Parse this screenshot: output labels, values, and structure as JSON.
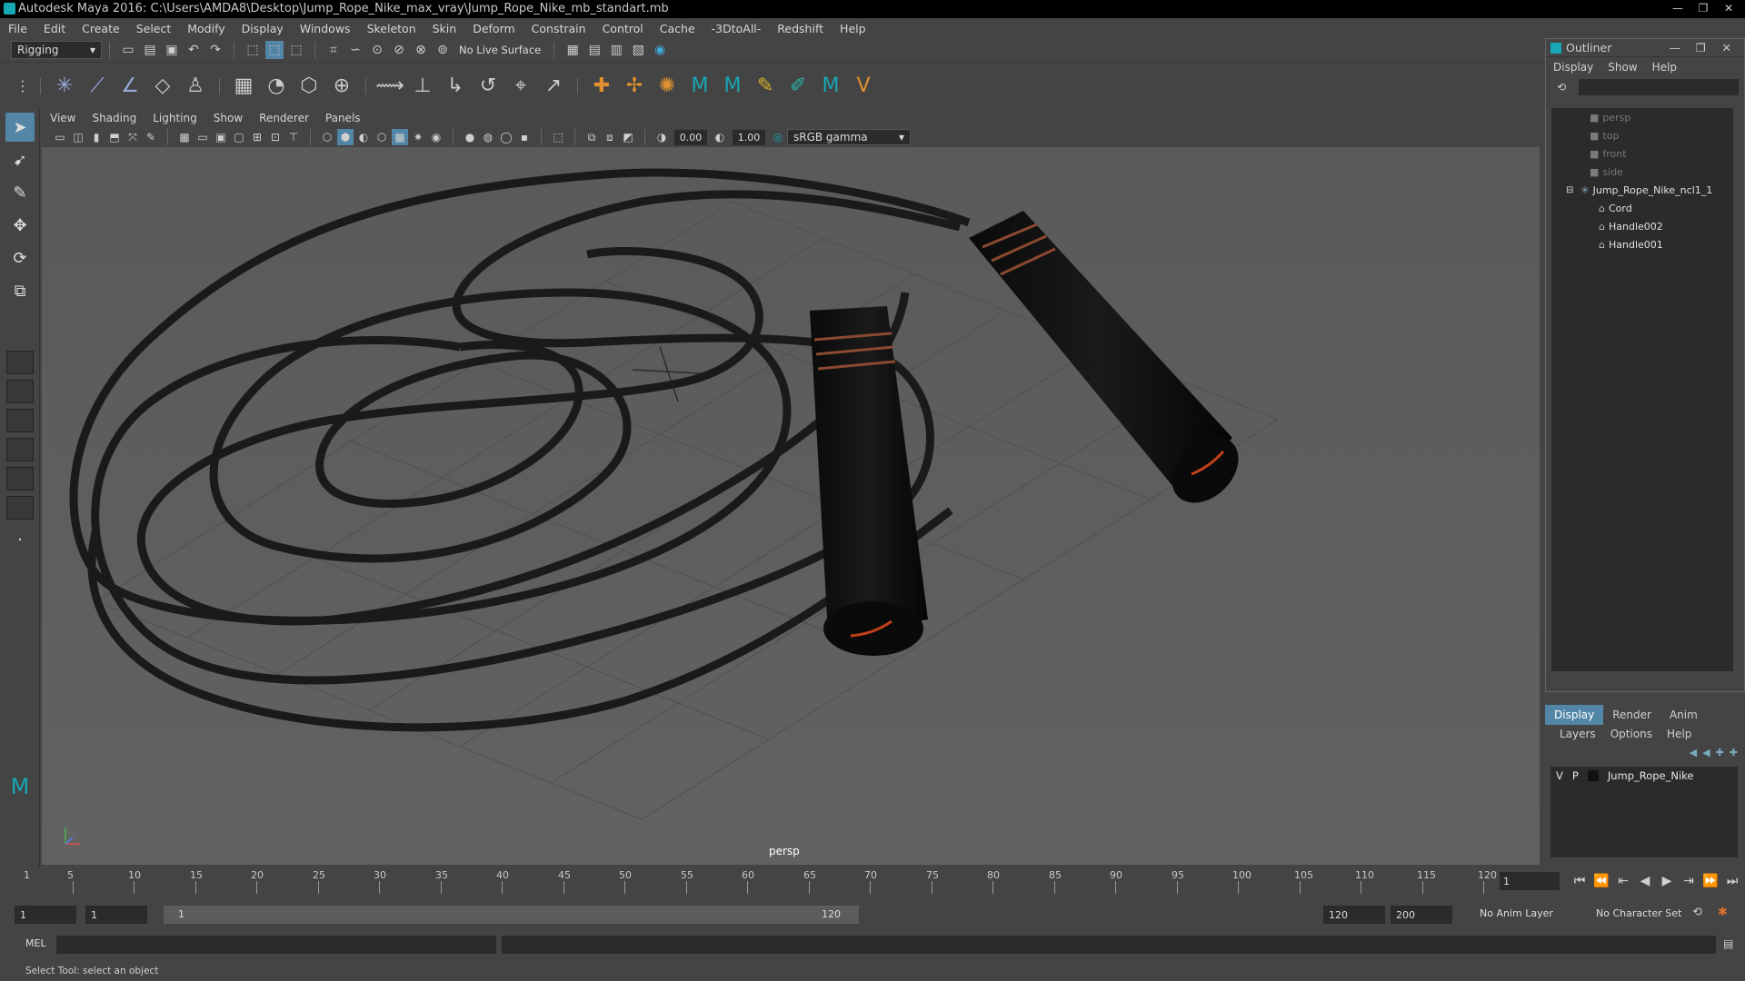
{
  "window": {
    "title": "Autodesk Maya 2016: C:\\Users\\AMDA8\\Desktop\\Jump_Rope_Nike_max_vray\\Jump_Rope_Nike_mb_standart.mb",
    "controls": [
      "—",
      "❐",
      "✕"
    ]
  },
  "menubar": [
    "File",
    "Edit",
    "Create",
    "Select",
    "Modify",
    "Display",
    "Windows",
    "Skeleton",
    "Skin",
    "Deform",
    "Constrain",
    "Control",
    "Cache",
    "-3DtoAll-",
    "Redshift",
    "Help"
  ],
  "statusline": {
    "menuset": "Rigging",
    "live_surface": "No Live Surface"
  },
  "panel": {
    "menus": [
      "View",
      "Shading",
      "Lighting",
      "Show",
      "Renderer",
      "Panels"
    ],
    "exposure": "0.00",
    "gamma": "1.00",
    "colorspace": "sRGB gamma",
    "camera_label": "persp"
  },
  "outliner": {
    "title": "Outliner",
    "menus": [
      "Display",
      "Show",
      "Help"
    ],
    "cameras": [
      "persp",
      "top",
      "front",
      "side"
    ],
    "group": "Jump_Rope_Nike_ncl1_1",
    "children": [
      "Cord",
      "Handle002",
      "Handle001"
    ]
  },
  "layers": {
    "tabs": [
      "Display",
      "Render",
      "Anim"
    ],
    "active_tab": "Display",
    "menus": [
      "Layers",
      "Options",
      "Help"
    ],
    "rows": [
      {
        "v": "V",
        "p": "P",
        "name": "Jump_Rope_Nike"
      }
    ]
  },
  "timeline": {
    "ticks": [
      "5",
      "10",
      "15",
      "20",
      "25",
      "30",
      "35",
      "40",
      "45",
      "50",
      "55",
      "60",
      "65",
      "70",
      "75",
      "80",
      "85",
      "90",
      "95",
      "100",
      "105",
      "110",
      "115",
      "120"
    ],
    "start_label": "1",
    "current_frame": "1"
  },
  "range": {
    "start": "1",
    "playback_start": "1",
    "slider_start": "1",
    "slider_end": "120",
    "playback_end": "120",
    "end": "200",
    "anim_layer": "No Anim Layer",
    "character_set": "No Character Set"
  },
  "cmdline": {
    "mel_label": "MEL"
  },
  "helpline": "Select Tool: select an object",
  "colors": {
    "accent": "#5285a6",
    "viewport_bg": "#5d5d5d",
    "panel_bg": "#444444",
    "field_bg": "#2b2b2b"
  }
}
